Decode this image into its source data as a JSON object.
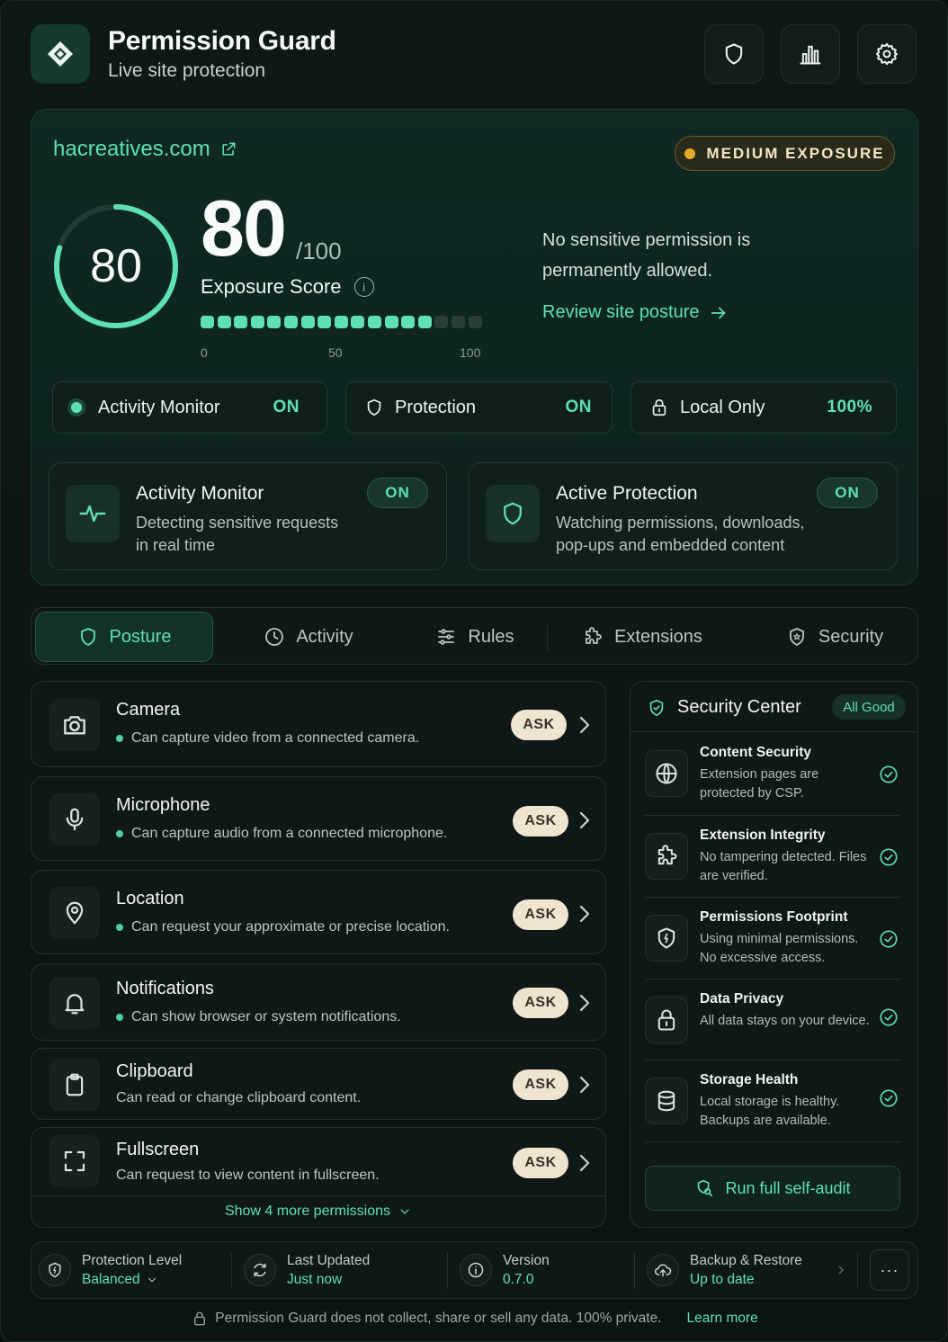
{
  "app": {
    "title": "Permission Guard",
    "subtitle": "Live site protection"
  },
  "header_buttons": [
    {
      "icon": "shield-icon"
    },
    {
      "icon": "bar-chart-icon"
    },
    {
      "icon": "gear-icon"
    }
  ],
  "site": {
    "domain": "hacreatives.com",
    "exposure_badge": "MEDIUM EXPOSURE",
    "score": 80,
    "score_ring": "80",
    "score_big": "80",
    "score_max": "/100",
    "score_label": "Exposure Score",
    "scale_ticks": [
      "0",
      "50",
      "100"
    ],
    "segments_total": 17,
    "segments_on": 14,
    "posture_text": "No sensitive permission is permanently allowed.",
    "review_link": "Review site posture"
  },
  "status_pills": [
    {
      "label": "Activity Monitor",
      "value": "ON"
    },
    {
      "label": "Protection",
      "value": "ON"
    },
    {
      "label": "Local Only",
      "value": "100%"
    }
  ],
  "feature_cards": [
    {
      "title": "Activity Monitor",
      "desc_line1": "Detecting sensitive requests",
      "desc_line2": "in real time",
      "badge": "ON"
    },
    {
      "title": "Active Protection",
      "desc_line1": "Watching permissions, downloads,",
      "desc_line2": "pop-ups and embedded content",
      "badge": "ON"
    }
  ],
  "tabs": [
    {
      "label": "Posture",
      "active": true
    },
    {
      "label": "Activity"
    },
    {
      "label": "Rules"
    },
    {
      "label": "Extensions"
    },
    {
      "label": "Security"
    }
  ],
  "permissions": [
    {
      "title": "Camera",
      "desc": "Can capture video from a connected camera.",
      "status": "ASK",
      "icon": "camera-icon"
    },
    {
      "title": "Microphone",
      "desc": "Can capture audio from a connected microphone.",
      "status": "ASK",
      "icon": "microphone-icon"
    },
    {
      "title": "Location",
      "desc": "Can request your approximate or precise location.",
      "status": "ASK",
      "icon": "location-pin-icon"
    },
    {
      "title": "Notifications",
      "desc": "Can show browser or system notifications.",
      "status": "ASK",
      "icon": "bell-icon"
    },
    {
      "title": "Clipboard",
      "desc": "Can read or change clipboard content.",
      "status": "ASK",
      "icon": "clipboard-icon"
    },
    {
      "title": "Fullscreen",
      "desc": "Can request to view content in fullscreen.",
      "status": "ASK",
      "icon": "fullscreen-icon"
    }
  ],
  "show_more": "Show 4 more permissions",
  "security_center": {
    "title": "Security Center",
    "badge": "All Good",
    "items": [
      {
        "title": "Content Security",
        "desc": "Extension pages are protected by CSP.",
        "icon": "globe-icon"
      },
      {
        "title": "Extension Integrity",
        "desc": "No tampering detected. Files are verified.",
        "icon": "puzzle-icon"
      },
      {
        "title": "Permissions Footprint",
        "desc": "Using minimal permissions. No excessive access.",
        "icon": "shield-icon"
      },
      {
        "title": "Data Privacy",
        "desc": "All data stays on your device.",
        "icon": "lock-icon"
      },
      {
        "title": "Storage Health",
        "desc": "Local storage is healthy. Backups are available.",
        "icon": "database-icon"
      }
    ],
    "audit_button": "Run full self-audit"
  },
  "footer": {
    "items": [
      {
        "label": "Protection Level",
        "value": "Balanced"
      },
      {
        "label": "Last Updated",
        "value": "Just now"
      },
      {
        "label": "Version",
        "value": "0.7.0"
      },
      {
        "label": "Backup & Restore",
        "value": "Up to date"
      }
    ],
    "more_button": "···"
  },
  "privacy_note": "Permission Guard does not collect, share or sell any data. 100% private.",
  "privacy_link": "Learn more",
  "colors": {
    "accent": "#5fe0b4",
    "warning": "#e5a92a",
    "background": "#0b1412"
  }
}
